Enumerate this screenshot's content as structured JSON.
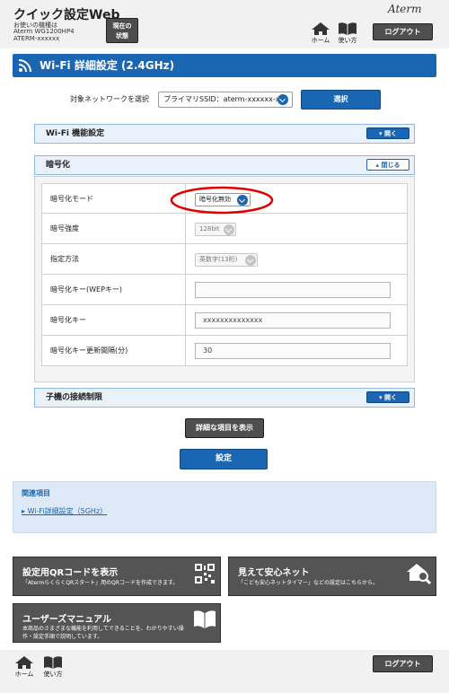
{
  "header": {
    "title": "クイック設定Web",
    "device_line1": "お使いの機種は",
    "device_line2": "Aterm WG1200HP4",
    "device_line3": "ATERM-xxxxxx",
    "status_button": [
      "現在の",
      "状態"
    ],
    "logo": "Aterm",
    "home_label": "ホーム",
    "manual_label": "使い方",
    "logout_label": "ログアウト"
  },
  "page": {
    "title": "Wi-Fi 詳細設定 (2.4GHz)"
  },
  "network": {
    "label": "対象ネットワークを選択",
    "selected": "プライマリSSID：aterm-xxxxxx-x",
    "select_button": "選択"
  },
  "sections": {
    "wifi_function": {
      "label": "Wi-Fi 機能設定",
      "toggle": "開く"
    },
    "encryption": {
      "label": "暗号化",
      "toggle": "閉じる"
    },
    "client_limit": {
      "label": "子機の接続制限",
      "toggle": "開く"
    }
  },
  "encryption_rows": [
    {
      "label": "暗号化モード",
      "value": "暗号化無効"
    },
    {
      "label": "暗号強度",
      "value": "128bit"
    },
    {
      "label": "指定方法",
      "value": "英数字(13桁)"
    },
    {
      "label": "暗号化キー(WEPキー)",
      "value": ""
    },
    {
      "label": "暗号化キー",
      "value": "xxxxxxxxxxxxxx"
    },
    {
      "label": "暗号化キー更新間隔(分)",
      "value": "30"
    }
  ],
  "actions": {
    "show_details": "詳細な項目を表示",
    "apply": "設定"
  },
  "related": {
    "title": "関連項目",
    "link": "Wi-Fi詳細設定（5GHz）"
  },
  "cards": {
    "qr": {
      "title": "設定用QRコードを表示",
      "desc": "「AtermらくらくQRスタート」用のQRコードを作成できます。"
    },
    "safe_net": {
      "title": "見えて安心ネット",
      "desc": "「こども安心ネットタイマー」などの設定はこちらから。"
    },
    "manual": {
      "title": "ユーザーズマニュアル",
      "desc1": "本商品のさまざまな機能を利用してできることを、わかりやすい操",
      "desc2": "作・設定手順で説明しています。"
    }
  },
  "footer": {
    "home_label": "ホーム",
    "manual_label": "使い方",
    "logout_label": "ログアウト"
  },
  "colors": {
    "accent": "#1a66b3",
    "highlight": "#e00000",
    "dark_button": "#4f4f4f"
  }
}
